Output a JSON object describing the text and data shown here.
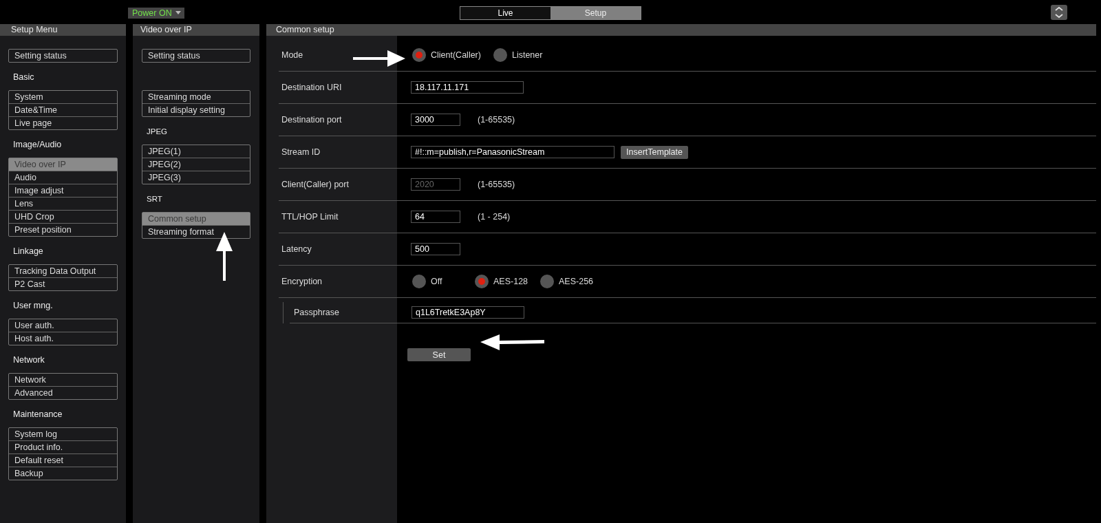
{
  "top_bar": {
    "power_menu": {
      "label": "Power ON"
    },
    "tabs": [
      {
        "label": "Live",
        "selected": false
      },
      {
        "label": "Setup",
        "selected": true
      }
    ]
  },
  "setup_menu": {
    "title": "Setup Menu",
    "groups": [
      {
        "items": [
          {
            "label": "Setting status",
            "selected": false
          }
        ]
      },
      {
        "heading": "Basic",
        "items": [
          {
            "label": "System",
            "selected": false
          },
          {
            "label": "Date&Time",
            "selected": false
          },
          {
            "label": "Live page",
            "selected": false
          }
        ]
      },
      {
        "heading": "Image/Audio",
        "items": [
          {
            "label": "Video over IP",
            "selected": true
          },
          {
            "label": "Audio",
            "selected": false
          },
          {
            "label": "Image adjust",
            "selected": false
          },
          {
            "label": "Lens",
            "selected": false
          },
          {
            "label": "UHD Crop",
            "selected": false
          },
          {
            "label": "Preset position",
            "selected": false
          }
        ]
      },
      {
        "heading": "Linkage",
        "items": [
          {
            "label": "Tracking Data Output",
            "selected": false
          },
          {
            "label": "P2 Cast",
            "selected": false
          }
        ]
      },
      {
        "heading": "User mng.",
        "items": [
          {
            "label": "User auth.",
            "selected": false
          },
          {
            "label": "Host auth.",
            "selected": false
          }
        ]
      },
      {
        "heading": "Network",
        "items": [
          {
            "label": "Network",
            "selected": false
          },
          {
            "label": "Advanced",
            "selected": false
          }
        ]
      },
      {
        "heading": "Maintenance",
        "items": [
          {
            "label": "System log",
            "selected": false
          },
          {
            "label": "Product info.",
            "selected": false
          },
          {
            "label": "Default reset",
            "selected": false
          },
          {
            "label": "Backup",
            "selected": false
          }
        ]
      }
    ]
  },
  "submenu": {
    "title": "Video over IP",
    "groups": [
      {
        "items": [
          {
            "label": "Setting status",
            "selected": false
          }
        ]
      },
      {
        "items": [
          {
            "label": "Streaming mode",
            "selected": false
          },
          {
            "label": "Initial display setting",
            "selected": false
          }
        ]
      },
      {
        "heading": "JPEG",
        "items": [
          {
            "label": "JPEG(1)",
            "selected": false
          },
          {
            "label": "JPEG(2)",
            "selected": false
          },
          {
            "label": "JPEG(3)",
            "selected": false
          }
        ]
      },
      {
        "heading": "SRT",
        "items": [
          {
            "label": "Common setup",
            "selected": true
          },
          {
            "label": "Streaming format",
            "selected": false
          }
        ]
      }
    ]
  },
  "form": {
    "title": "Common setup",
    "rows": [
      {
        "kind": "radio",
        "label": "Mode",
        "options": [
          {
            "label": "Client(Caller)",
            "selected": true
          },
          {
            "label": "Listener",
            "selected": false
          }
        ]
      },
      {
        "kind": "text",
        "label": "Destination URI",
        "value": "18.117.11.171",
        "disabled": false
      },
      {
        "kind": "number",
        "label": "Destination port",
        "value": "3000",
        "disabled": false,
        "hint": "(1-65535)"
      },
      {
        "kind": "id",
        "label": "Stream ID",
        "value": "#!::m=publish,r=PanasonicStream",
        "disabled": false,
        "button": "InsertTemplate"
      },
      {
        "kind": "number",
        "label": "Client(Caller) port",
        "value": "2020",
        "disabled": true,
        "hint": "(1-65535)"
      },
      {
        "kind": "number",
        "label": "TTL/HOP Limit",
        "value": "64",
        "disabled": false,
        "hint": "(1 - 254)"
      },
      {
        "kind": "number",
        "label": "Latency",
        "value": "500",
        "disabled": false
      },
      {
        "kind": "radio",
        "label": "Encryption",
        "options": [
          {
            "label": "Off",
            "selected": false
          },
          {
            "label": "AES-128",
            "selected": true
          },
          {
            "label": "AES-256",
            "selected": false
          }
        ]
      },
      {
        "kind": "subtext",
        "label": "Passphrase",
        "value": "q1L6TretkE3Ap8Y",
        "disabled": false
      }
    ],
    "submit": {
      "label": "Set"
    }
  }
}
